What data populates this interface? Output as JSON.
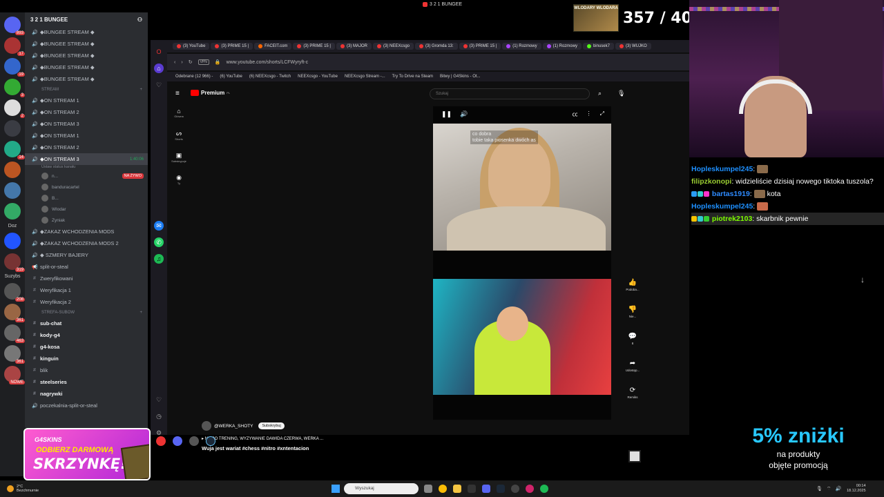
{
  "window": {
    "title": "3 2 1 BUNGEE"
  },
  "discord": {
    "server_name": "3 2 1 BUNGEE",
    "server_badges": [
      "893",
      "17",
      "19",
      "3",
      "2",
      "14",
      "319",
      "208",
      "361",
      "463",
      "361",
      "NOWE"
    ],
    "server_text": [
      "Doz",
      "Suzybs"
    ],
    "channels_top": [
      "◆BUNGEE STREAM ◆",
      "◆BUNGEE STREAM ◆",
      "◆BUNGEE STREAM ◆",
      "◆BUNGEE STREAM ◆",
      "◆BUNGEE STREAM ◆"
    ],
    "category_stream": "STREAM",
    "stream_channels": [
      "◆ON STREAM 1",
      "◆ON STREAM 2",
      "◆ON STREAM 3",
      "◆ON STREAM 1",
      "◆ON STREAM 2"
    ],
    "active_channel": {
      "name": "◆ON STREAM 3",
      "time": "1:40:06",
      "status": "Ustaw status kanału"
    },
    "users": [
      {
        "name": "n...",
        "live": "NA ŻYWO"
      },
      {
        "name": "banduracartel"
      },
      {
        "name": "B..."
      },
      {
        "name": "Wlodar"
      },
      {
        "name": "Zyniak"
      }
    ],
    "channels_mid": [
      "◆ZAKAZ WCHODZENIA MODS",
      "◆ZAKAZ WCHODZENIA MODS 2",
      "◆ SZMERY BAJERY",
      "split-or-steal",
      "Zweryfikowani",
      "Weryfikacja 1",
      "Weryfikacja 2"
    ],
    "category_sub": "STREFA-SUBOW",
    "sub_channels": [
      "sub-chat",
      "kody-g4",
      "g4-kosa",
      "kinguin",
      "blik",
      "steelseries",
      "nagrywki",
      "poczekalnia-split-or-steal"
    ]
  },
  "browser": {
    "tabs": [
      "(3) YouTube",
      "(3) PRIME 15 |",
      "FACEIT.com",
      "(3) PRIME 15 |",
      "(3) MAJOR",
      "(3) NEEXcsgo",
      "(3) Gromda 13:",
      "(3) PRIME 15 |",
      "(1) Rozmowy",
      "(1) Rozmowy",
      "binusek7",
      "(3) WUJKO"
    ],
    "url": "www.youtube.com/shorts/LCFWyryft-c",
    "vpn": "VPN",
    "bookmarks": [
      "Odebrane (12 966) -",
      "(6) YouTube",
      "(6) NEEXcsgo - Twitch",
      "NEEXcsgo - YouTube",
      "NEEXcsgo Stream -...",
      "Try To Drive na Steam",
      "Bitwy | G4Skins - Ot..."
    ]
  },
  "youtube": {
    "logo": "Premium",
    "logo_sup": "PL",
    "search_placeholder": "Szukaj",
    "nav": [
      "Główna",
      "Shorts",
      "Subskrypcje",
      "Ty"
    ],
    "caption_line1": "co dobra",
    "caption_line2": "tobie taka piosenka dwóch as",
    "actions": [
      "Podoba...",
      "Nie...",
      "8",
      "Udostęp...",
      "Remiks"
    ],
    "channel": "@WERKA_SHOTY",
    "subscribe": "Subskrybuj",
    "music": "NITRO TRENING, WYZYWANIE DAWIDA CZERWA, WERKA ...",
    "description": "Wuja jest wariat #chess #nitro #xntentacion"
  },
  "overlay": {
    "counter_badge": "WLODARY WLODARA",
    "counter": "357 / 400",
    "chat": [
      {
        "user": "Hopleskumpel245",
        "text": ""
      },
      {
        "user": "filipzkonopi",
        "text": "widzieliście dzisiaj nowego tiktoka tuszola?"
      },
      {
        "user": "bartas1919",
        "text": "kota"
      },
      {
        "user": "Hopleskumpel245",
        "text": ""
      },
      {
        "user": "piotrek2103",
        "text": "skarbnik pewnie"
      }
    ],
    "promo_brand": "G4SKINS",
    "promo_line1": "ODBIERZ DARMOWĄ",
    "promo_line2": "SKRZYNKĘ!",
    "promo_pct": "5% zniżki",
    "promo_sub1": "na produkty",
    "promo_sub2": "objęte promocją"
  },
  "taskbar": {
    "weather_temp": "2°C",
    "weather_desc": "Bezchmurnie",
    "search_placeholder": "Wyszukaj",
    "time": "00:14",
    "date": "18.12.2025"
  }
}
